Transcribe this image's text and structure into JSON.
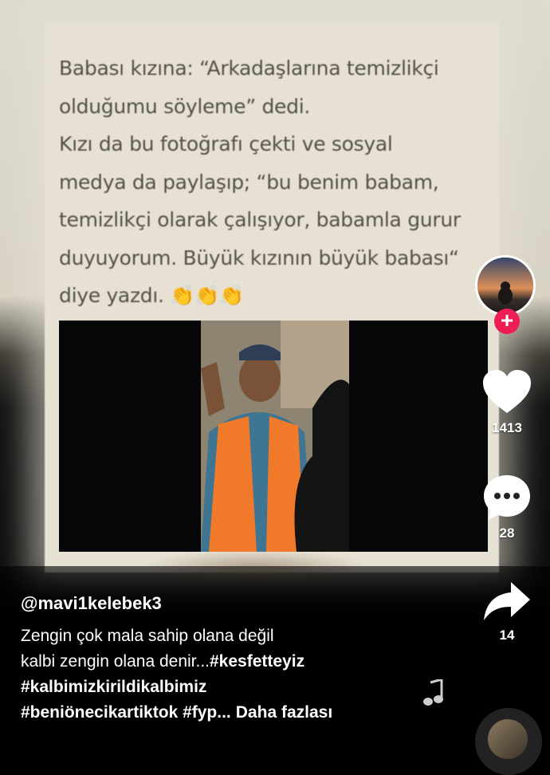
{
  "quote": {
    "lines": [
      "Babası kızına: “Arkadaşlarına temizlikçi",
      "olduğumu söyleme” dedi.",
      "Kızı da bu fotoğrafı çekti ve sosyal",
      "medya da paylaşıp; “bu benim babam,",
      "temizlikçi olarak çalışıyor, babamla gurur",
      "duyuyorum. Büyük kızının büyük babası“",
      "diye yazdı. 👏👏👏"
    ]
  },
  "actions": {
    "likes": "1413",
    "comments": "28",
    "shares": "14"
  },
  "caption": {
    "username": "@mavi1kelebek3",
    "text_line1": "Zengin çok mala sahip olana değil",
    "text_line2_plain": "kalbi zengin olana denir...",
    "tag1": "#kesfetteyiz",
    "tag2": "#kalbimizkirildikalbimiz",
    "tag3": "#beniönecikartiktok",
    "tag4": "#fyp...",
    "more": "Daha fazlası"
  },
  "icons": {
    "follow": "+",
    "like": "heart-icon",
    "comment": "comment-bubble-icon",
    "share": "share-arrow-icon",
    "music": "music-note-icon"
  },
  "colors": {
    "follow_badge": "#ee1d52",
    "background": "#000000",
    "card": "#e6e1d3"
  }
}
